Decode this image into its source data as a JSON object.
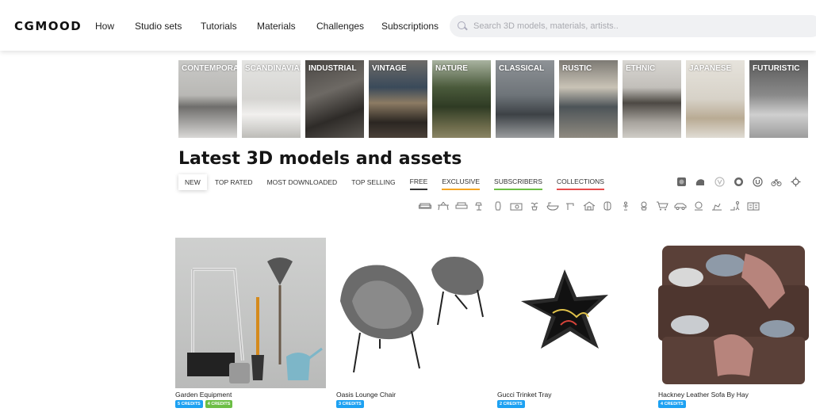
{
  "header": {
    "logo": "CGMOOD",
    "nav": [
      "How",
      "Studio sets",
      "Tutorials",
      "Materials",
      "Challenges",
      "Subscriptions"
    ],
    "search_placeholder": "Search 3D models, materials, artists.."
  },
  "styles": [
    {
      "label": "CONTEMPORARY"
    },
    {
      "label": "SCANDINAVIAN"
    },
    {
      "label": "INDUSTRIAL"
    },
    {
      "label": "VINTAGE"
    },
    {
      "label": "NATURE"
    },
    {
      "label": "CLASSICAL"
    },
    {
      "label": "RUSTIC"
    },
    {
      "label": "ETHNIC"
    },
    {
      "label": "JAPANESE"
    },
    {
      "label": "FUTURISTIC"
    }
  ],
  "main": {
    "heading": "Latest 3D models and assets",
    "tabs": [
      "NEW",
      "TOP RATED",
      "MOST DOWNLOADED",
      "TOP SELLING",
      "FREE",
      "EXCLUSIVE",
      "SUBSCRIBERS",
      "COLLECTIONS"
    ]
  },
  "filter_icons_row1": [
    "render-engine-icon",
    "shape-icon",
    "vray-icon",
    "corona-icon",
    "unreal-icon",
    "bicycle-icon",
    "gear-icon"
  ],
  "filter_icons_row2": [
    "sofa-icon",
    "table-icon",
    "bed-icon",
    "lamp-icon",
    "vase-icon",
    "kitchen-icon",
    "plant-icon",
    "bath-icon",
    "faucet-icon",
    "house-icon",
    "door-icon",
    "figure-icon",
    "flower-icon",
    "cart-icon",
    "car-icon",
    "clock-icon",
    "toy-icon",
    "person-icon",
    "book-icon"
  ],
  "products": [
    {
      "title": "Garden Equipment",
      "credits": [
        "5 CREDITS",
        "4 CREDITS"
      ]
    },
    {
      "title": "Oasis Lounge Chair",
      "credits": [
        "3 CREDITS"
      ]
    },
    {
      "title": "Gucci Trinket Tray",
      "credits": [
        "2 CREDITS"
      ]
    },
    {
      "title": "Hackney Leather Sofa By Hay",
      "credits": [
        "4 CREDITS"
      ]
    }
  ],
  "colors": {
    "badge_blue": "#1da1f2",
    "badge_green": "#6cbe45",
    "free": "#333333",
    "exclusive": "#f5a623",
    "subscribers": "#6cbe45",
    "collections": "#e74c4c"
  }
}
